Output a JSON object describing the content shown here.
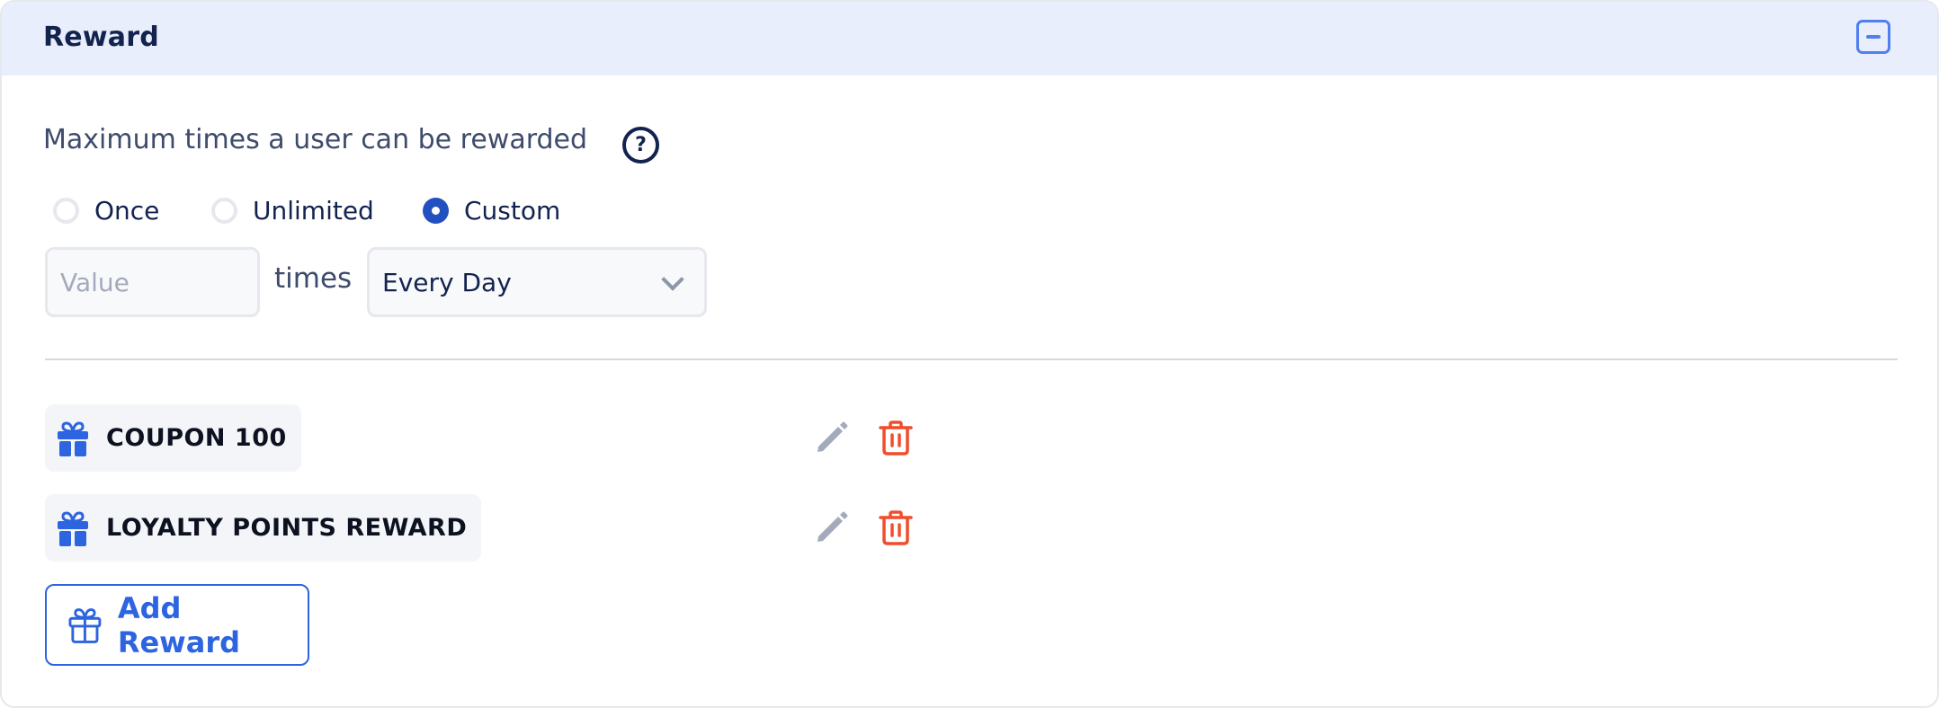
{
  "section": {
    "title": "Reward",
    "collapse_icon": "minus-square-icon"
  },
  "limit": {
    "question": "Maximum times a user can be rewarded",
    "help_icon": "question-circle-icon",
    "help_glyph": "?",
    "options": [
      {
        "label": "Once",
        "checked": false
      },
      {
        "label": "Unlimited",
        "checked": false
      },
      {
        "label": "Custom",
        "checked": true
      }
    ],
    "value_placeholder": "Value",
    "value": "",
    "times_label": "times",
    "period": "Every Day"
  },
  "rewards": [
    {
      "name": "COUPON 100",
      "icon": "gift-icon"
    },
    {
      "name": "LOYALTY POINTS REWARD",
      "icon": "gift-icon"
    }
  ],
  "actions": {
    "edit_icon": "pencil-icon",
    "delete_icon": "trash-icon",
    "add_label": "Add Reward"
  },
  "colors": {
    "accent": "#2d64e0",
    "radio_selected": "#2350c1",
    "delete": "#f04e2b",
    "edit": "#a3aabb",
    "header_bg": "#e8eefb"
  }
}
